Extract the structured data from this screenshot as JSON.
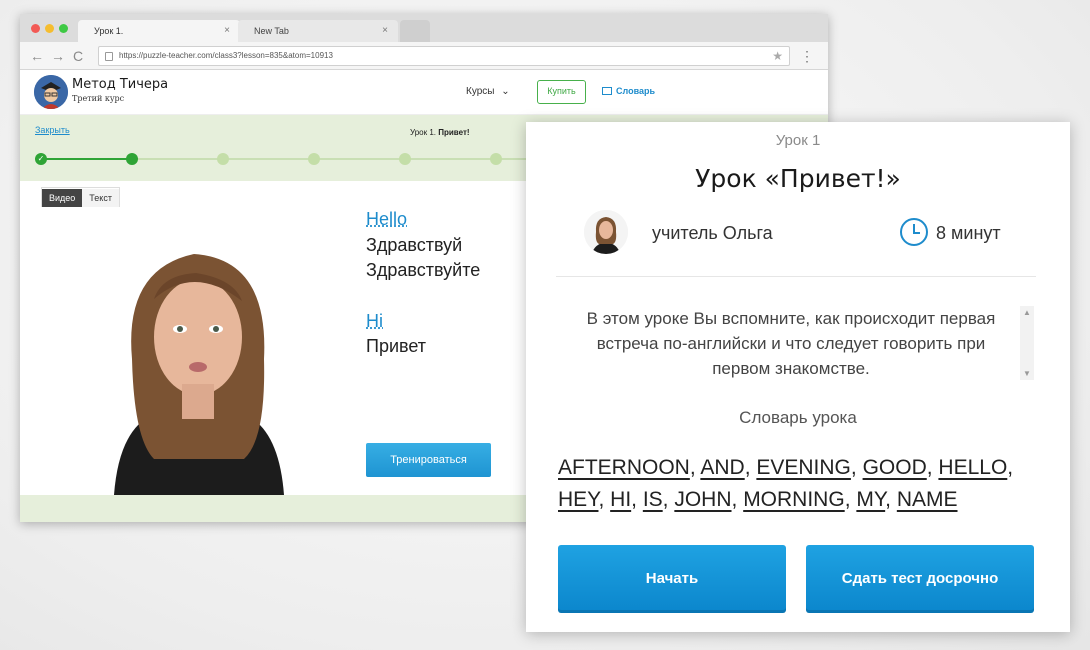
{
  "browser": {
    "tabs": [
      {
        "label": "Урок 1.",
        "close": "×"
      },
      {
        "label": "New Tab",
        "close": "×"
      }
    ],
    "nav": {
      "back": "←",
      "forward": "→",
      "reload": "C"
    },
    "url": "https://puzzle-teacher.com/class3?lesson=835&atom=10913",
    "star": "★",
    "menu": "⋮"
  },
  "site": {
    "logo_title": "Метод Тичера",
    "logo_subtitle": "Третий курс",
    "nav_courses": "Курсы",
    "nav_courses_chevron": "⌄",
    "buy_label": "Купить",
    "dictionary_label": "Словарь",
    "close_link": "Закрыть",
    "lesson_crumb_prefix": "Урок 1.",
    "lesson_crumb_name": "Привет!",
    "progress": {
      "total_steps": 6,
      "current_step": 2
    }
  },
  "lesson_view": {
    "tabs": [
      {
        "label": "Видео",
        "active": true
      },
      {
        "label": "Текст",
        "active": false
      }
    ],
    "phrases": [
      {
        "en": "Hello",
        "ru": [
          "Здравствуй",
          "Здравствуйте"
        ]
      },
      {
        "en": "Hi",
        "ru": [
          "Привет"
        ]
      }
    ],
    "train_button": "Тренироваться"
  },
  "modal": {
    "kicker": "Урок 1",
    "title": "Урок «Привет!»",
    "teacher": "учитель Ольга",
    "duration": "8 минут",
    "description": "В этом уроке Вы вспомните, как происходит первая встреча по-английски и что следует говорить при первом знакомстве.",
    "vocab_title": "Словарь урока",
    "vocab_words": [
      "AFTERNOON",
      "AND",
      "EVENING",
      "GOOD",
      "HELLO",
      "HEY",
      "HI",
      "IS",
      "JOHN",
      "MORNING",
      "MY",
      "NAME"
    ],
    "start_button": "Начать",
    "test_button": "Сдать тест досрочно",
    "scroll_up": "▲",
    "scroll_down": "▼"
  },
  "colors": {
    "accent_blue": "#1e8ccc",
    "buy_green": "#47b04b",
    "progress_green": "#2fa436",
    "lesson_bar_bg": "#e6efdb"
  }
}
